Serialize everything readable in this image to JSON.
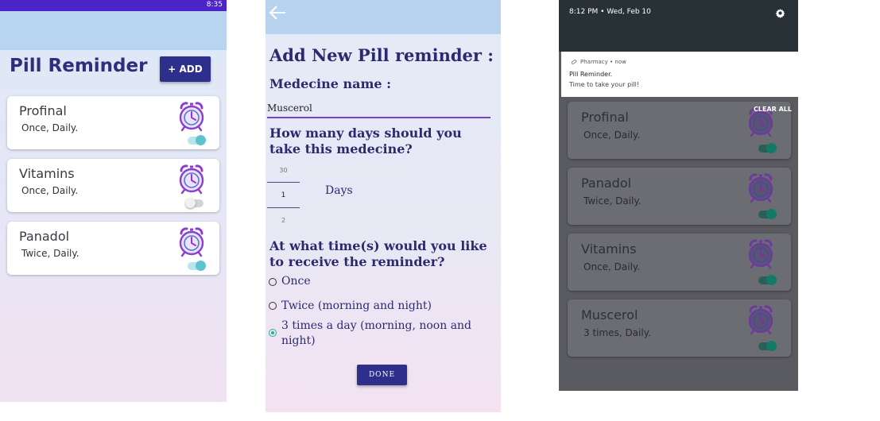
{
  "screen1": {
    "status_time": "8:35",
    "title": "Pill Reminder",
    "add_label": "+ ADD",
    "cards": [
      {
        "name": "Profinal",
        "frequency": "Once, Daily.",
        "enabled": true
      },
      {
        "name": "Vitamins",
        "frequency": "Once, Daily.",
        "enabled": false
      },
      {
        "name": "Panadol",
        "frequency": "Twice, Daily.",
        "enabled": true
      }
    ]
  },
  "screen2": {
    "title": "Add New Pill reminder :",
    "medicine_label": "Medecine name :",
    "medicine_value": "Muscerol",
    "days_question": "How many days should you take this medecine?",
    "picker": {
      "prev": "30",
      "selected": "1",
      "next": "2"
    },
    "days_label": "Days",
    "time_question": "At what time(s) would you like to receive the reminder?",
    "options": [
      {
        "label": "Once",
        "checked": false
      },
      {
        "label": "Twice (morning and night)",
        "checked": false
      },
      {
        "label": "3 times a day (morning, noon and night)",
        "checked": true
      }
    ],
    "done_label": "DONE"
  },
  "screen3": {
    "status": "8:12 PM • Wed, Feb 10",
    "notification": {
      "app": "Pharmacy • now",
      "title": "Pill Reminder.",
      "text": "Time to take your pill!"
    },
    "clear_all": "CLEAR ALL",
    "cards": [
      {
        "name": "Profinal",
        "frequency": "Once, Daily.",
        "enabled": true
      },
      {
        "name": "Panadol",
        "frequency": "Twice, Daily.",
        "enabled": true
      },
      {
        "name": "Vitamins",
        "frequency": "Once, Daily.",
        "enabled": true
      },
      {
        "name": "Muscerol",
        "frequency": "3 times, Daily.",
        "enabled": true
      }
    ]
  },
  "colors": {
    "primary": "#2e2f8c",
    "status_bar": "#4a23c9",
    "app_bar": "#b7d4f0",
    "toggle_on": "#5fc3cf",
    "radio_checked": "#1fb39a",
    "alarm_icon": "#8a3fd1"
  },
  "icons": {
    "alarm": "alarm-clock-icon",
    "back": "back-arrow-icon",
    "settings": "gear-icon",
    "notification_app": "pill-icon"
  }
}
